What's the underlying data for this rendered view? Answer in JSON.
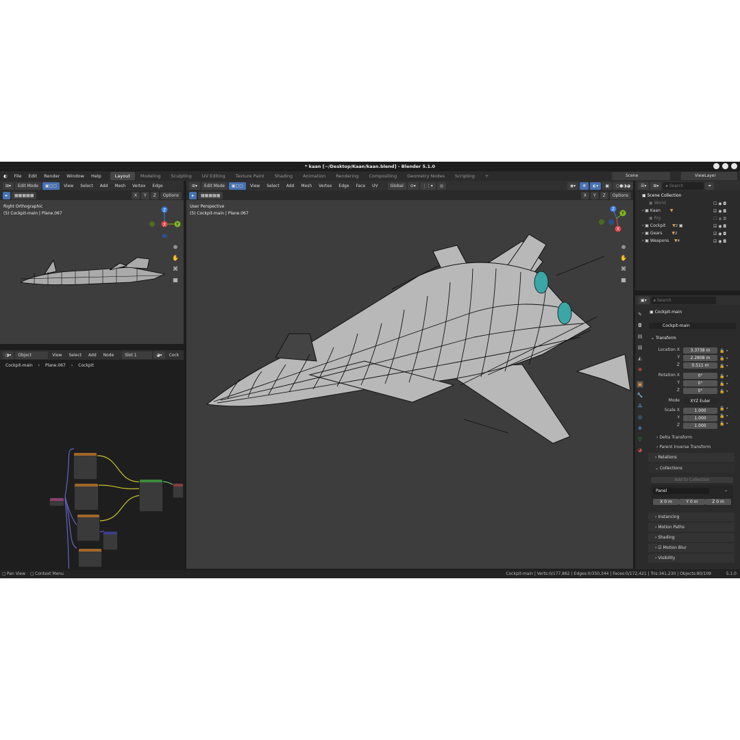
{
  "window": {
    "title": "* kaan [~/Desktop/Kaan/kaan.blend] - Blender 5.1.0"
  },
  "menu": [
    "File",
    "Edit",
    "Render",
    "Window",
    "Help"
  ],
  "workspaces": [
    "Layout",
    "Modeling",
    "Sculpting",
    "UV Editing",
    "Texture Paint",
    "Shading",
    "Animation",
    "Rendering",
    "Compositing",
    "Geometry Nodes",
    "Scripting"
  ],
  "scene": {
    "name": "Scene",
    "view_layer": "ViewLayer"
  },
  "left_view": {
    "mode": "Edit Mode",
    "menus": [
      "View",
      "Select",
      "Add",
      "Mesh",
      "Vertex",
      "Edge"
    ],
    "axes": [
      "X",
      "Y",
      "Z"
    ],
    "options": "Options",
    "title": "Right Orthographic",
    "subtitle": "(5) Cockpit-main | Plane.067",
    "gizmo": {
      "z": "Z",
      "x": "X",
      "y": "Y"
    }
  },
  "main_view": {
    "mode": "Edit Mode",
    "menus": [
      "View",
      "Select",
      "Add",
      "Mesh",
      "Vertex",
      "Edge",
      "Face",
      "UV"
    ],
    "orientation": "Global",
    "axes": [
      "X",
      "Y",
      "Z"
    ],
    "options": "Options",
    "title": "User Perspective",
    "subtitle": "(5) Cockpit-main | Plane.067",
    "gizmo": {
      "z": "Z",
      "x": "X",
      "y": "Y"
    }
  },
  "shader": {
    "type": "Object",
    "menus": [
      "View",
      "Select",
      "Add",
      "Node"
    ],
    "slot": "Slot 1",
    "material_cut": "Cock",
    "breadcrumb": [
      "Cockpit-main",
      "Plane.067",
      "Cockpit"
    ]
  },
  "outliner": {
    "search_placeholder": "Search",
    "root": "Scene Collection",
    "items": [
      {
        "name": "World",
        "dim": true
      },
      {
        "name": "Kaan",
        "dim": false
      },
      {
        "name": "Rig",
        "dim": true
      },
      {
        "name": "Cockpit",
        "dim": false,
        "count": "2"
      },
      {
        "name": "Gears",
        "dim": false,
        "count": "2"
      },
      {
        "name": "Weapons",
        "dim": false,
        "count": "4"
      }
    ]
  },
  "properties": {
    "search_placeholder": "Search",
    "object_name": "Cockpit-main",
    "data_name": "Cockpit-main",
    "transform_label": "Transform",
    "location": {
      "label": "Location X",
      "x": "3.3738 m",
      "y": "2.2808 m",
      "z": "0.511 m"
    },
    "rotation": {
      "label": "Rotation X",
      "x": "0°",
      "y": "0°",
      "z": "0°"
    },
    "mode_label": "Mode",
    "mode_value": "XYZ Euler",
    "scale": {
      "label": "Scale X",
      "x": "1.000",
      "y": "1.000",
      "z": "1.000"
    },
    "axis_y": "Y",
    "axis_z": "Z",
    "delta": "Delta Transform",
    "parent_inverse": "Parent Inverse Transform",
    "relations": "Relations",
    "collections": "Collections",
    "add_to_collection": "Add to Collection",
    "panel_name": "Panel",
    "panel_x": "X  0 m",
    "panel_y": "Y  0 m",
    "panel_z": "Z  0 m",
    "instancing": "Instancing",
    "motion_paths": "Motion Paths",
    "shading": "Shading",
    "motion_blur": "Motion Blur",
    "visibility": "Visibility"
  },
  "status": {
    "pan": "Pan View",
    "context": "Context Menu",
    "stats": "Cockpit-main | Verts:0/177,862 | Edges:0/350,344 | Faces:0/172,421 | Tris:341,230 | Objects:80/109",
    "version": "5.1.0"
  },
  "colors": {
    "x_axis": "#e5444d",
    "y_axis": "#84b71e",
    "z_axis": "#3b7de0",
    "accent": "#4772b3"
  }
}
